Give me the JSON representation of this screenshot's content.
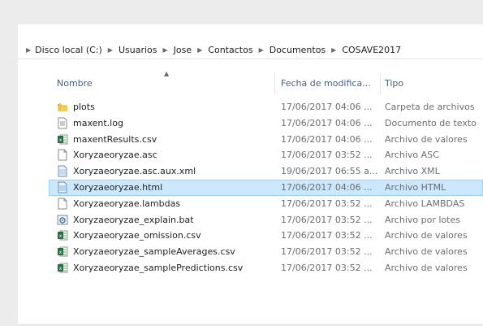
{
  "breadcrumb": [
    "Disco local (C:)",
    "Usuarios",
    "Jose",
    "Contactos",
    "Documentos",
    "COSAVE2017"
  ],
  "columns": {
    "name": "Nombre",
    "date": "Fecha de modifica...",
    "type": "Tipo"
  },
  "files": [
    {
      "name": "plots",
      "date": "17/06/2017 04:06 ...",
      "type": "Carpeta de archivos",
      "icon": "folder-icon"
    },
    {
      "name": "maxent.log",
      "date": "17/06/2017 04:06 ...",
      "type": "Documento de texto",
      "icon": "text-file-icon"
    },
    {
      "name": "maxentResults.csv",
      "date": "17/06/2017 04:06 ...",
      "type": "Archivo de valores",
      "icon": "excel-file-icon"
    },
    {
      "name": "Xoryzaeoryzae.asc",
      "date": "17/06/2017 03:52 ...",
      "type": "Archivo ASC",
      "icon": "blank-file-icon"
    },
    {
      "name": "Xoryzaeoryzae.asc.aux.xml",
      "date": "19/06/2017 06:55 a...",
      "type": "Archivo XML",
      "icon": "xml-file-icon"
    },
    {
      "name": "Xoryzaeoryzae.html",
      "date": "17/06/2017 04:06 ...",
      "type": "Archivo HTML",
      "icon": "html-file-icon"
    },
    {
      "name": "Xoryzaeoryzae.lambdas",
      "date": "17/06/2017 03:52 ...",
      "type": "Archivo LAMBDAS",
      "icon": "blank-file-icon"
    },
    {
      "name": "Xoryzaeoryzae_explain.bat",
      "date": "17/06/2017 03:52 ...",
      "type": "Archivo por lotes",
      "icon": "batch-file-icon"
    },
    {
      "name": "Xoryzaeoryzae_omission.csv",
      "date": "17/06/2017 03:52 ...",
      "type": "Archivo de valores",
      "icon": "excel-file-icon"
    },
    {
      "name": "Xoryzaeoryzae_sampleAverages.csv",
      "date": "17/06/2017 03:52 ...",
      "type": "Archivo de valores",
      "icon": "excel-file-icon"
    },
    {
      "name": "Xoryzaeoryzae_samplePredictions.csv",
      "date": "17/06/2017 03:52 ...",
      "type": "Archivo de valores",
      "icon": "excel-file-icon"
    }
  ],
  "selected_index": 5,
  "colors": {
    "selection": "#cce8ff",
    "selection_border": "#99d1ff",
    "header_text": "#4c607a"
  }
}
